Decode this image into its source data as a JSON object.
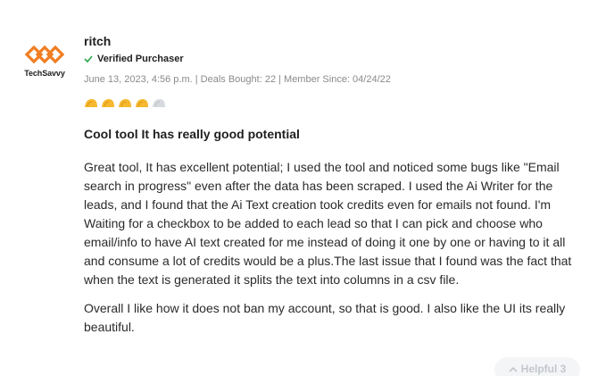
{
  "reviewer": {
    "avatar_text": "TechSavvy",
    "name": "ritch",
    "verified_label": "Verified Purchaser",
    "meta": "June 13, 2023, 4:56 p.m. | Deals Bought: 22 | Member Since: 04/24/22"
  },
  "rating": {
    "value": 4,
    "max": 5,
    "icon": "taco-icon",
    "filled_color": "#f5b82e",
    "empty_color": "#d6d9dd"
  },
  "review": {
    "title": "Cool tool It has really good potential",
    "paragraphs": [
      "Great tool, It has excellent potential; I used the tool and noticed some bugs like \"Email search in progress\" even after the data has been scraped. I used the Ai Writer for the leads, and I found that the Ai Text creation took credits even for emails not found. I'm Waiting for a checkbox to be added to each lead so that I can pick and choose who email/info to have AI text created for me instead of doing it one by one or having to it all and consume a lot of credits would be a plus.The last issue that I found was the fact that when the text is generated it splits the text into columns in a csv file.",
      "Overall I like how it does not ban my account, so that is good. I also like the UI its really beautiful."
    ]
  },
  "helpful": {
    "label": "Helpful 3"
  },
  "colors": {
    "brand_orange": "#f07d22",
    "verified_check": "#27a64b"
  }
}
